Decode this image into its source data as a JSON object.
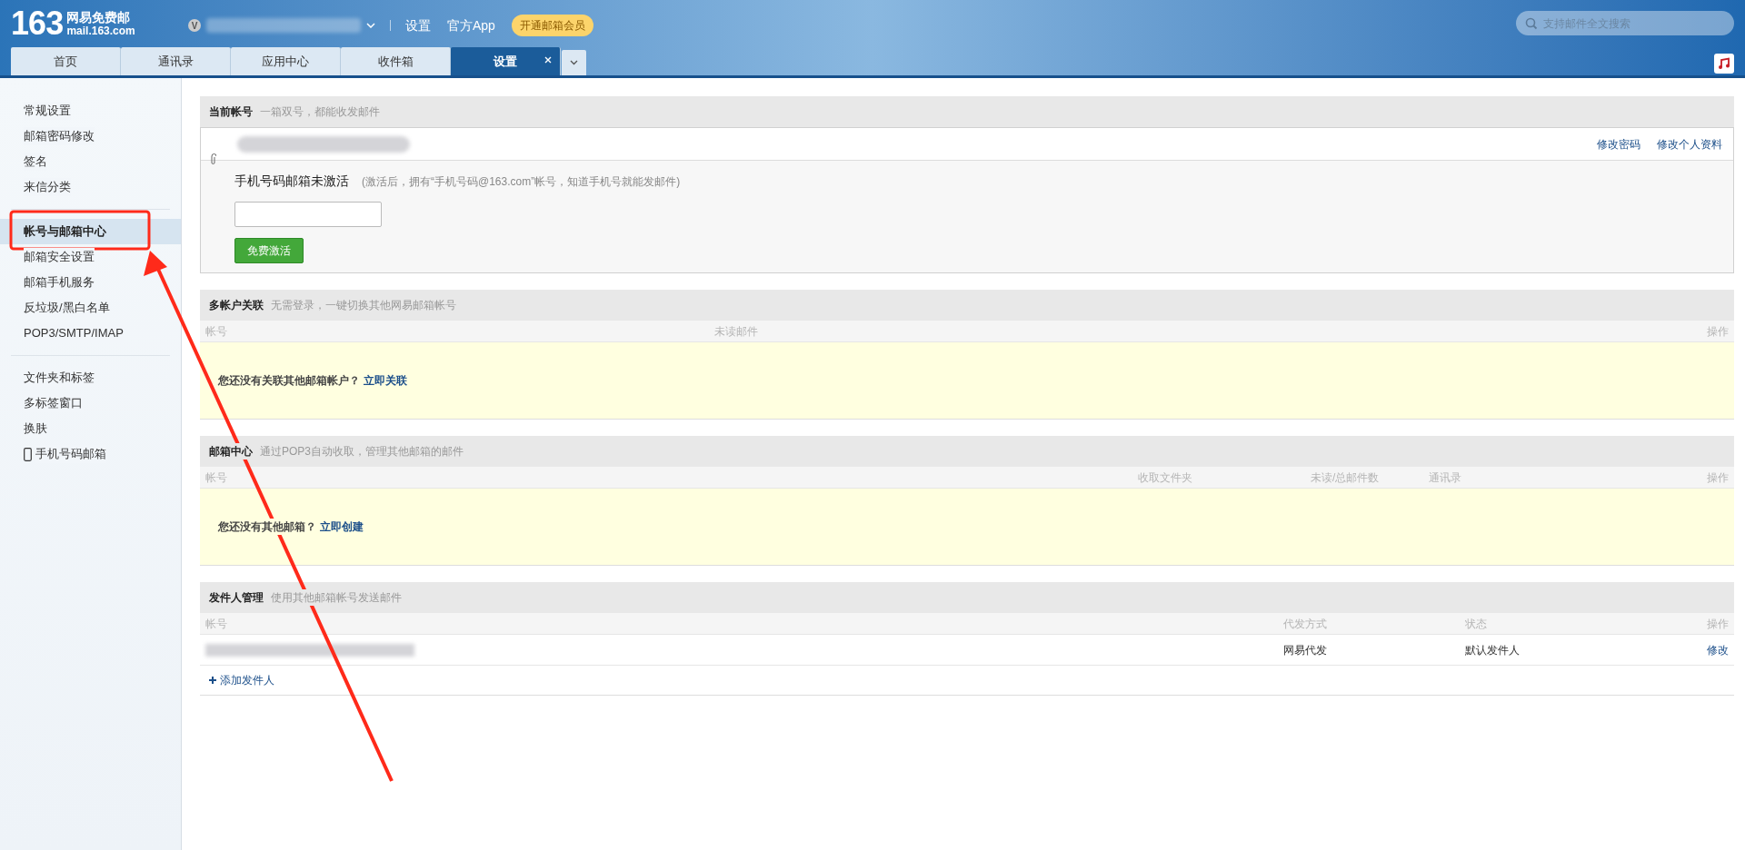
{
  "header": {
    "logo_number": "163",
    "logo_name": "网易免费邮",
    "logo_domain": "mail.163.com",
    "account_badge": "V",
    "links": [
      "设置",
      "官方App"
    ],
    "vip_button": "开通邮箱会员",
    "search": {
      "placeholder": "支持邮件全文搜索"
    }
  },
  "tabs": [
    {
      "label": "首页",
      "selected": false,
      "closable": false
    },
    {
      "label": "通讯录",
      "selected": false,
      "closable": false
    },
    {
      "label": "应用中心",
      "selected": false,
      "closable": false
    },
    {
      "label": "收件箱",
      "selected": false,
      "closable": false
    },
    {
      "label": "设置",
      "selected": true,
      "closable": true
    }
  ],
  "sidebar": {
    "groups": [
      {
        "items": [
          {
            "label": "常规设置",
            "selected": false,
            "kind": "text"
          },
          {
            "label": "邮箱密码修改",
            "selected": false,
            "kind": "text"
          },
          {
            "label": "签名",
            "selected": false,
            "kind": "text"
          },
          {
            "label": "来信分类",
            "selected": false,
            "kind": "text"
          }
        ]
      },
      {
        "items": [
          {
            "label": "帐号与邮箱中心",
            "selected": true,
            "kind": "text"
          },
          {
            "label": "邮箱安全设置",
            "selected": false,
            "kind": "text"
          },
          {
            "label": "邮箱手机服务",
            "selected": false,
            "kind": "text"
          },
          {
            "label": "反垃圾/黑白名单",
            "selected": false,
            "kind": "text"
          },
          {
            "label": "POP3/SMTP/IMAP",
            "selected": false,
            "kind": "text"
          }
        ]
      },
      {
        "items": [
          {
            "label": "文件夹和标签",
            "selected": false,
            "kind": "text"
          },
          {
            "label": "多标签窗口",
            "selected": false,
            "kind": "text"
          },
          {
            "label": "换肤",
            "selected": false,
            "kind": "text"
          },
          {
            "label": "手机号码邮箱",
            "selected": false,
            "kind": "phone"
          }
        ]
      }
    ]
  },
  "current_account": {
    "title": "当前帐号",
    "subtitle": "一箱双号，都能收发邮件",
    "links": [
      "修改密码",
      "修改个人资料"
    ],
    "phone_status": "手机号码邮箱未激活",
    "phone_hint": "(激活后，拥有“手机号码@163.com”帐号，知道手机号就能发邮件)",
    "activate_button": "免费激活"
  },
  "sections": [
    {
      "kind": "empty",
      "title": "多帐户关联",
      "subtitle": "无需登录，一键切换其他网易邮箱帐号",
      "columns": [
        "帐号",
        "未读邮件",
        "操作"
      ],
      "empty_text": "您还没有关联其他邮箱帐户？",
      "empty_link": "立即关联"
    },
    {
      "kind": "empty",
      "title": "邮箱中心",
      "subtitle": "通过POP3自动收取，管理其他邮箱的邮件",
      "columns": [
        "帐号",
        "收取文件夹",
        "未读/总邮件数",
        "通讯录",
        "操作"
      ],
      "empty_text": "您还没有其他邮箱？",
      "empty_link": "立即创建"
    },
    {
      "kind": "rows",
      "title": "发件人管理",
      "subtitle": "使用其他邮箱帐号发送邮件",
      "columns": [
        "帐号",
        "代发方式",
        "状态",
        "操作"
      ],
      "rows": [
        {
          "cells": [
            "",
            "网易代发",
            "默认发件人"
          ],
          "action": "修改"
        }
      ],
      "add_link": "添加发件人"
    }
  ]
}
